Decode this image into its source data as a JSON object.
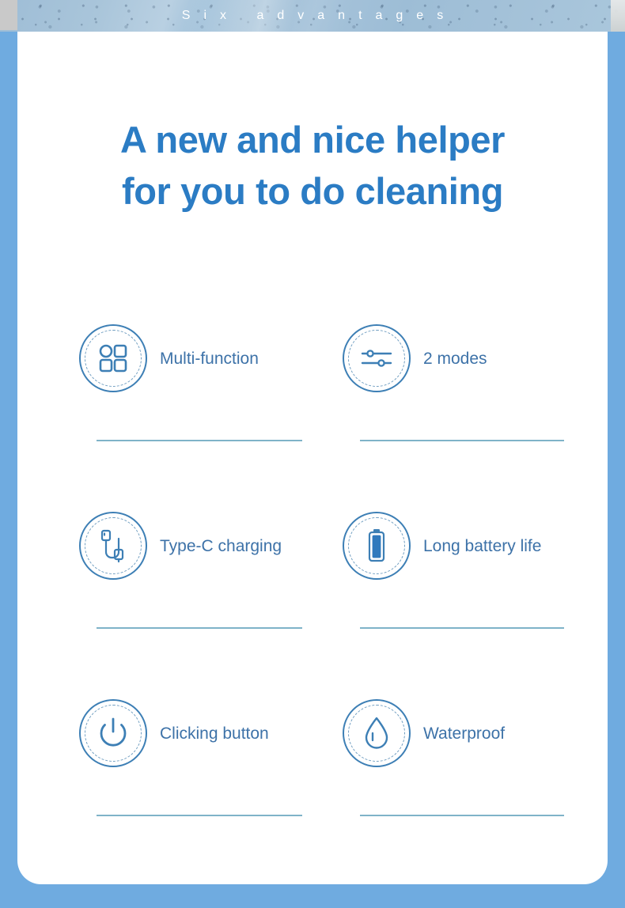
{
  "header": {
    "title": "Six advantages",
    "band_color": "#9bbcd7",
    "text_color": "#ffffff"
  },
  "frame": {
    "border_color": "#6fabe0",
    "card_color": "#ffffff"
  },
  "headline": {
    "line_1": "A new and nice helper",
    "line_2": "for you to do cleaning",
    "color": "#2b7cc4"
  },
  "features": {
    "label_color": "#3d72a8",
    "icon_color": "#3d7fb5",
    "divider_color": "#7fb3c8",
    "rows": [
      [
        {
          "icon": "grid-icon",
          "label": "Multi-function"
        },
        {
          "icon": "sliders-icon",
          "label": "2 modes"
        }
      ],
      [
        {
          "icon": "usb-cable-icon",
          "label": "Type-C charging"
        },
        {
          "icon": "battery-icon",
          "label": "Long battery life"
        }
      ],
      [
        {
          "icon": "power-icon",
          "label": "Clicking button"
        },
        {
          "icon": "water-drop-icon",
          "label": "Waterproof"
        }
      ]
    ]
  }
}
